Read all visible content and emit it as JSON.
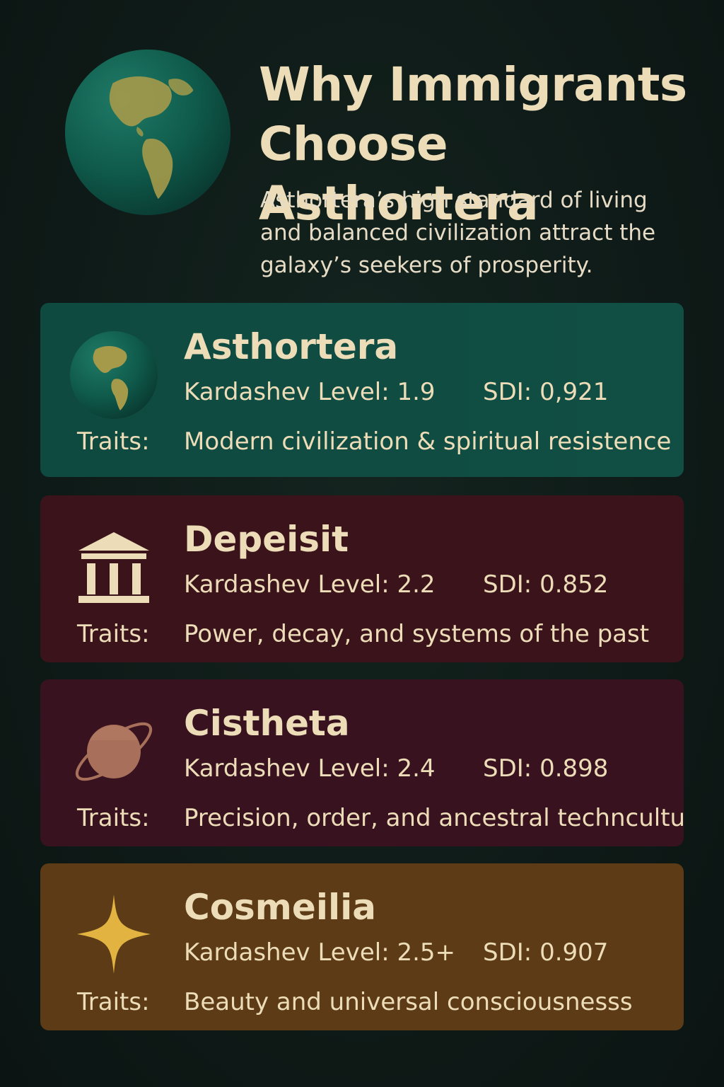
{
  "header": {
    "title_line1": "Why Immigrants",
    "title_line2": "Choose Asthortera",
    "subtitle_line1": "Asthortera’s high standard of living",
    "subtitle_line2": "and balanced civilization attract the",
    "subtitle_line3": "galaxy’s seekers of prosperity."
  },
  "labels": {
    "kardashev_prefix": "Kardashev Level: ",
    "sdi_prefix": "SDI: ",
    "traits_label": "Traits:"
  },
  "cards": [
    {
      "name": "Asthortera",
      "kardashev": "1.9",
      "sdi": "0,921",
      "traits": "Modern civilization & spiritual resistence",
      "icon": "globe-icon",
      "color": "#0f4a40"
    },
    {
      "name": "Depeisit",
      "kardashev": "2.2",
      "sdi": "0.852",
      "traits": "Power, decay, and systems of the past",
      "icon": "columns-building-icon",
      "color": "#3b141b"
    },
    {
      "name": "Cistheta",
      "kardashev": "2.4",
      "sdi": "0.898",
      "traits": "Precision, order, and ancestral techn­culture",
      "icon": "ringed-planet-icon",
      "color": "#38131f"
    },
    {
      "name": "Cosmeilia",
      "kardashev": "2.5+",
      "sdi": "0.907",
      "traits": "Beauty and universal consciousnesss",
      "icon": "four-point-star-icon",
      "color": "#5c3b16"
    }
  ]
}
